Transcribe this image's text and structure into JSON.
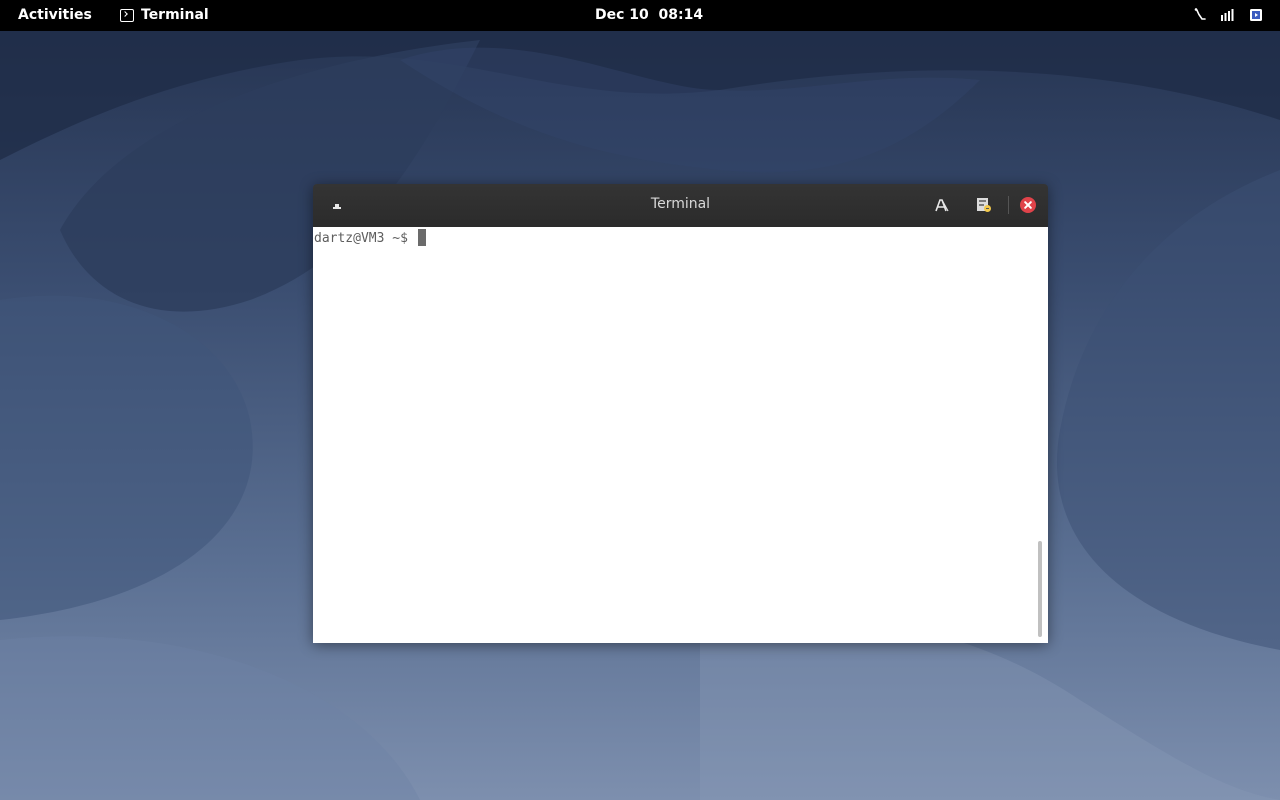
{
  "topbar": {
    "activities_label": "Activities",
    "app_name": "Terminal",
    "clock": "Dec 10  08:14",
    "icons": [
      "accessibility-icon",
      "volume-icon",
      "power-menu-icon"
    ]
  },
  "window": {
    "title": "Terminal",
    "buttons": [
      "new-tab-icon",
      "search-icon",
      "menu-icon",
      "close-icon"
    ],
    "prompt": "dartz@VM3 ~$ "
  },
  "colors": {
    "topbar_bg": "#000000",
    "titlebar_bg": "#2b2b2b",
    "terminal_bg": "#ffffff",
    "terminal_text": "#5e5e5e",
    "close_button": "#e0434a"
  }
}
